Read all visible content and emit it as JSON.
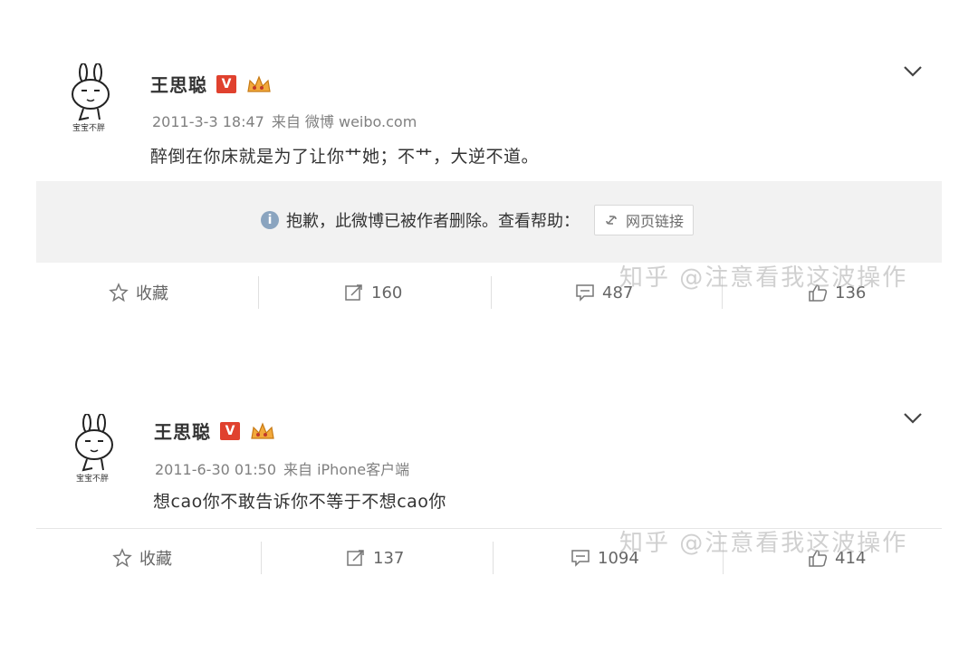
{
  "posts": [
    {
      "username": "王思聪",
      "v_badge": "V",
      "timestamp": "2011-3-3 18:47",
      "source": "来自 微博 weibo.com",
      "text": "醉倒在你床就是为了让你艹她；不艹，大逆不道。",
      "deleted_notice": "抱歉，此微博已被作者删除。查看帮助：",
      "link_label": "网页链接",
      "favorite_label": "收藏",
      "repost_count": "160",
      "comment_count": "487",
      "like_count": "136",
      "watermark": "知乎 @注意看我这波操作",
      "avatar_caption": "宝宝不胖"
    },
    {
      "username": "王思聪",
      "v_badge": "V",
      "timestamp": "2011-6-30 01:50",
      "source": "来自 iPhone客户端",
      "text": "想cao你不敢告诉你不等于不想cao你",
      "favorite_label": "收藏",
      "repost_count": "137",
      "comment_count": "1094",
      "like_count": "414",
      "watermark": "知乎 @注意看我这波操作",
      "avatar_caption": "宝宝不胖"
    }
  ],
  "colors": {
    "badge_red": "#e0412e",
    "meta_gray": "#808080",
    "deleted_bg": "#f2f2f2"
  },
  "icons": {
    "chevron": "chevron-down-icon",
    "info": "info-icon",
    "link": "link-icon",
    "favorite": "star-icon",
    "repost": "repost-icon",
    "comment": "comment-icon",
    "like": "thumbs-up-icon"
  }
}
